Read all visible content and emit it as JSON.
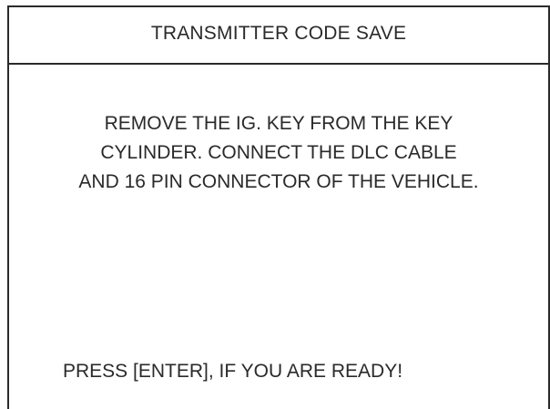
{
  "title": "TRANSMITTER CODE SAVE",
  "instructions": {
    "line1": "REMOVE THE IG. KEY FROM THE KEY",
    "line2": "CYLINDER. CONNECT THE DLC CABLE",
    "line3": "AND 16 PIN CONNECTOR OF THE VEHICLE."
  },
  "prompt": "PRESS [ENTER], IF YOU ARE READY!"
}
